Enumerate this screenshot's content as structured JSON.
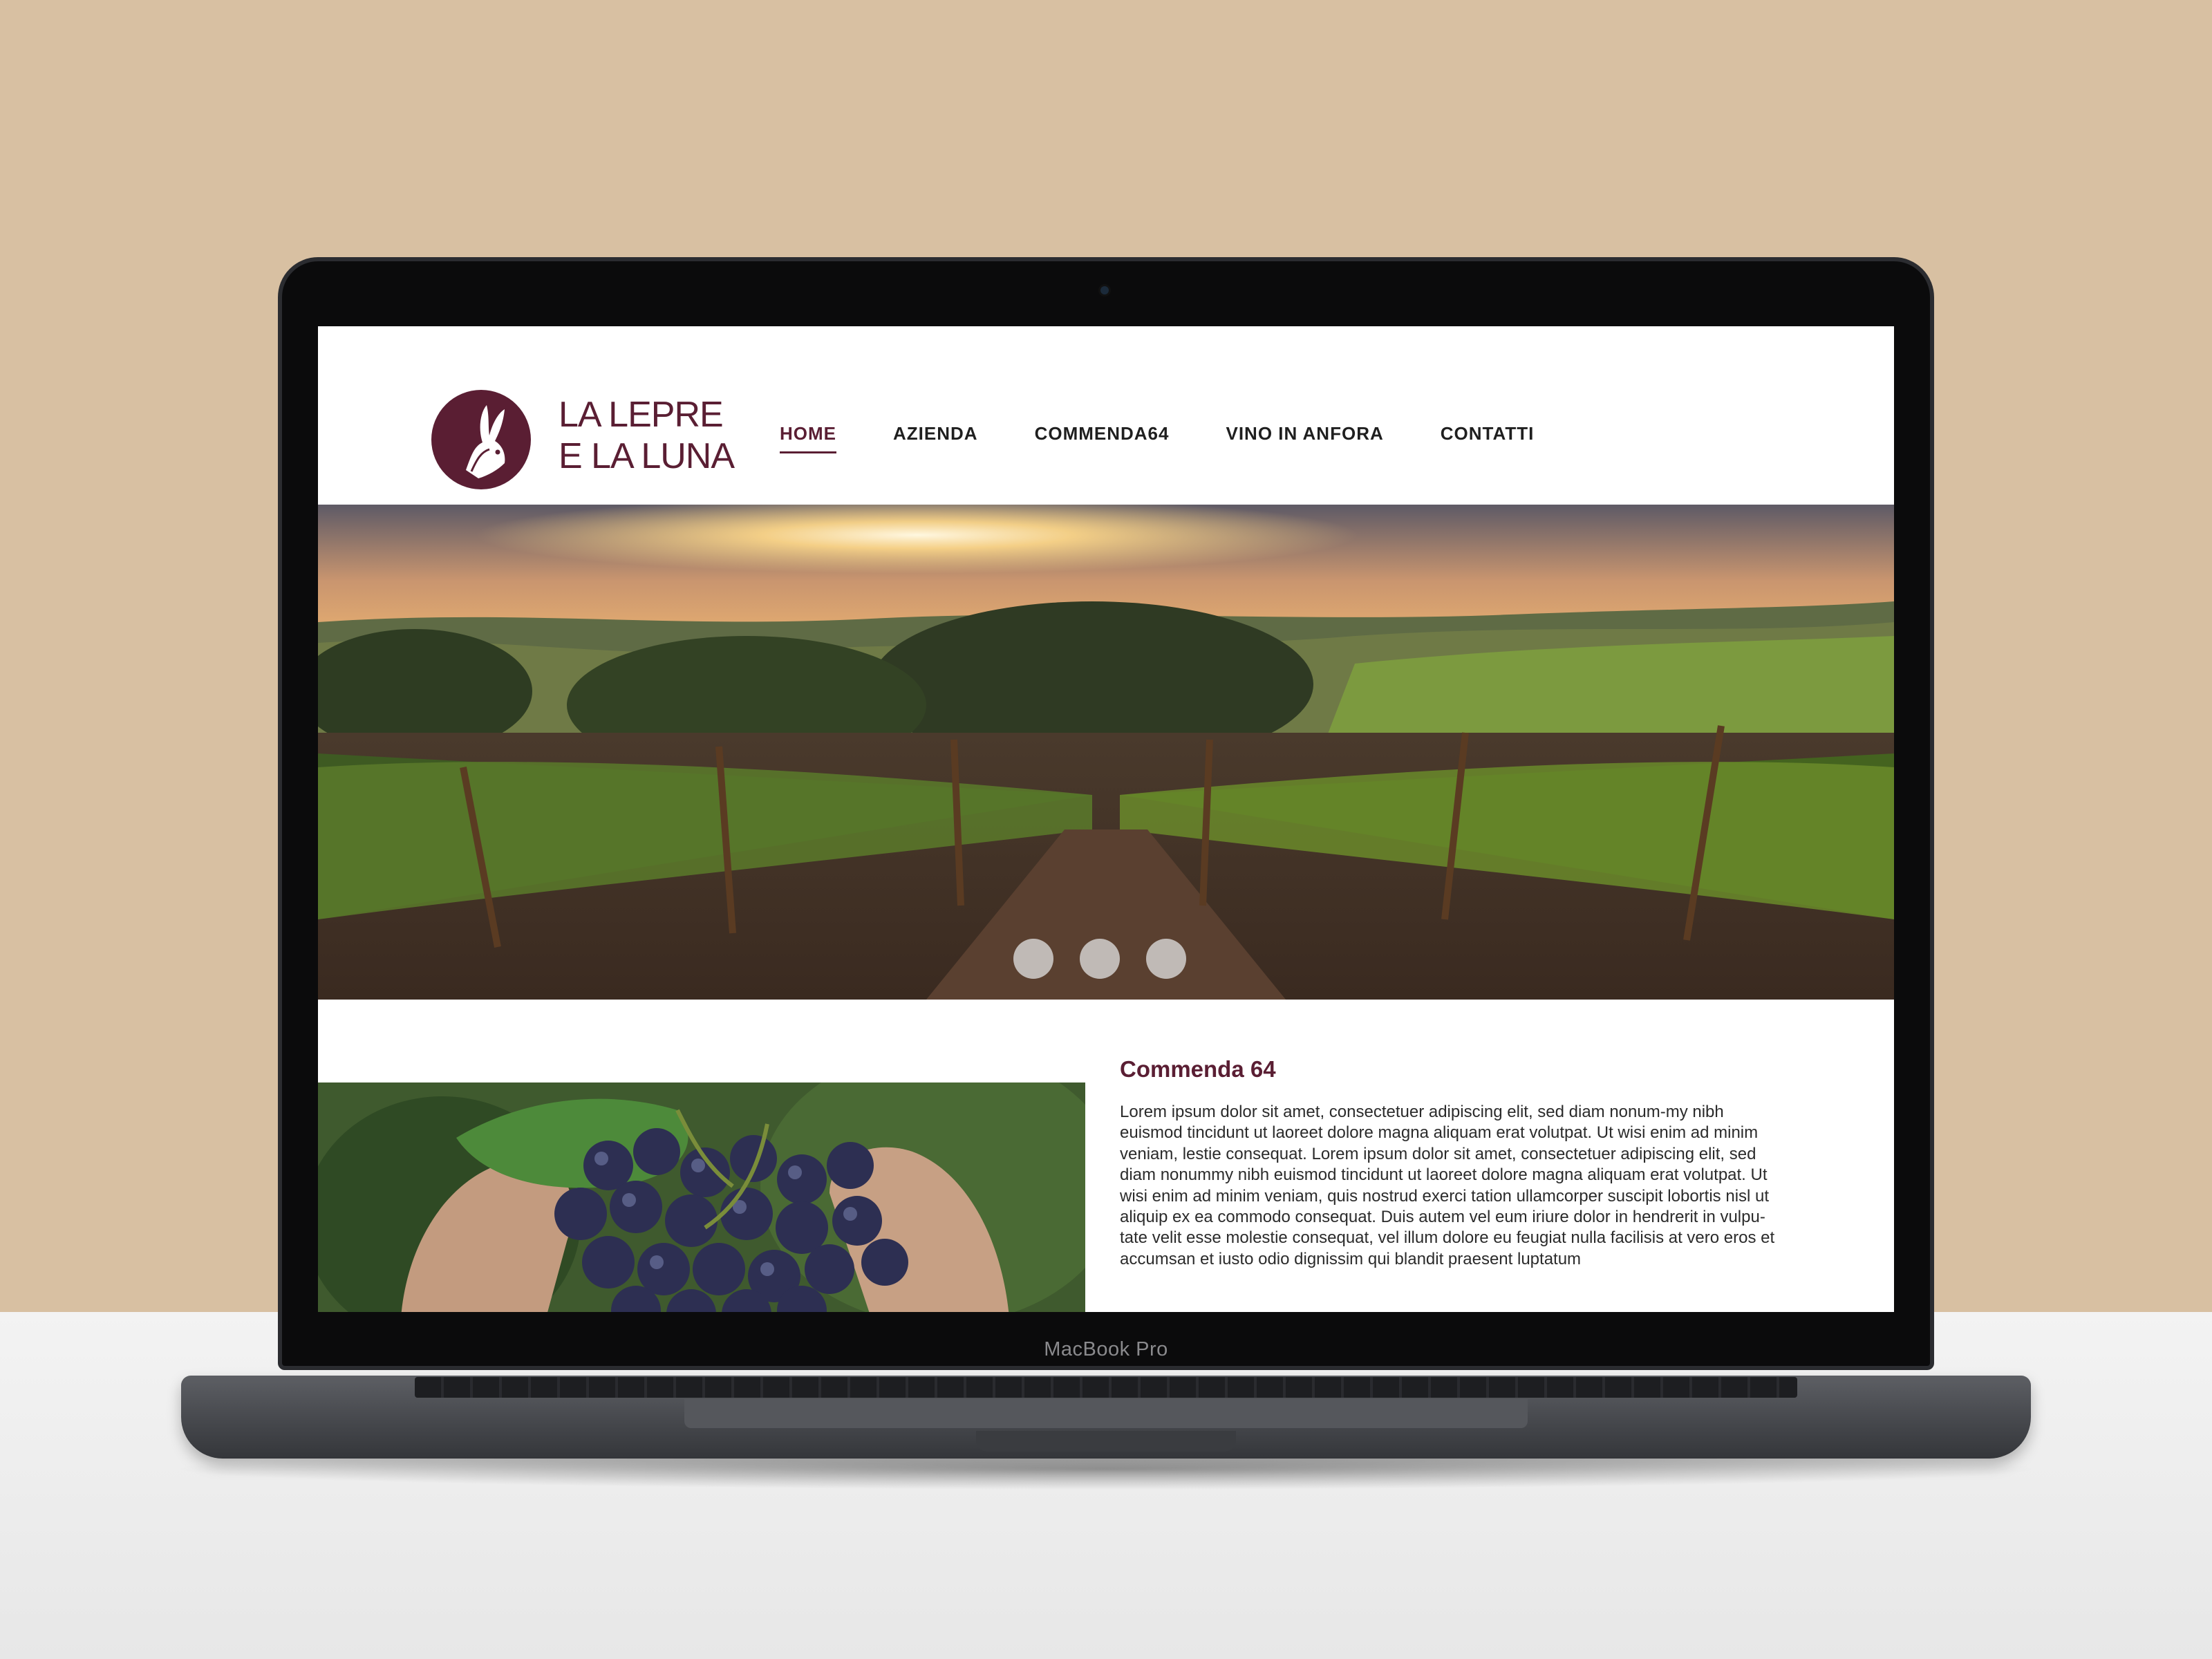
{
  "device": {
    "label": "MacBook Pro"
  },
  "brand": {
    "line1": "LA LEPRE",
    "line2": "E LA LUNA",
    "color": "#5a1e33"
  },
  "nav": {
    "items": [
      {
        "label": "HOME",
        "active": true
      },
      {
        "label": "AZIENDA"
      },
      {
        "label": "COMMENDA64"
      },
      {
        "label": "VINO IN ANFORA"
      },
      {
        "label": "CONTATTI"
      }
    ]
  },
  "hero": {
    "slide_count": 3,
    "image": "vineyard-sunset-photo"
  },
  "section": {
    "title": "Commenda 64",
    "image": "grapes-in-hands-photo",
    "body": "Lorem ipsum dolor sit amet, consectetuer adipiscing elit, sed diam nonum-my nibh euismod tincidunt ut laoreet dolore magna aliquam erat volutpat. Ut wisi enim ad minim veniam, lestie consequat. Lorem ipsum dolor sit amet, consectetuer adipiscing elit, sed diam nonummy nibh euismod tincidunt ut laoreet dolore magna aliquam erat volutpat. Ut wisi enim ad minim veniam, quis nostrud exerci tation ullamcorper suscipit lobortis nisl ut aliquip ex ea commodo consequat. Duis autem vel eum iriure dolor in hendrerit in vulpu-tate velit esse molestie consequat, vel illum dolore eu feugiat nulla facilisis at vero eros et accumsan et iusto odio dignissim qui blandit praesent luptatum"
  },
  "colors": {
    "background": "#d8c0a2",
    "accent": "#5a1e33",
    "laptop": "#4a4c51"
  }
}
